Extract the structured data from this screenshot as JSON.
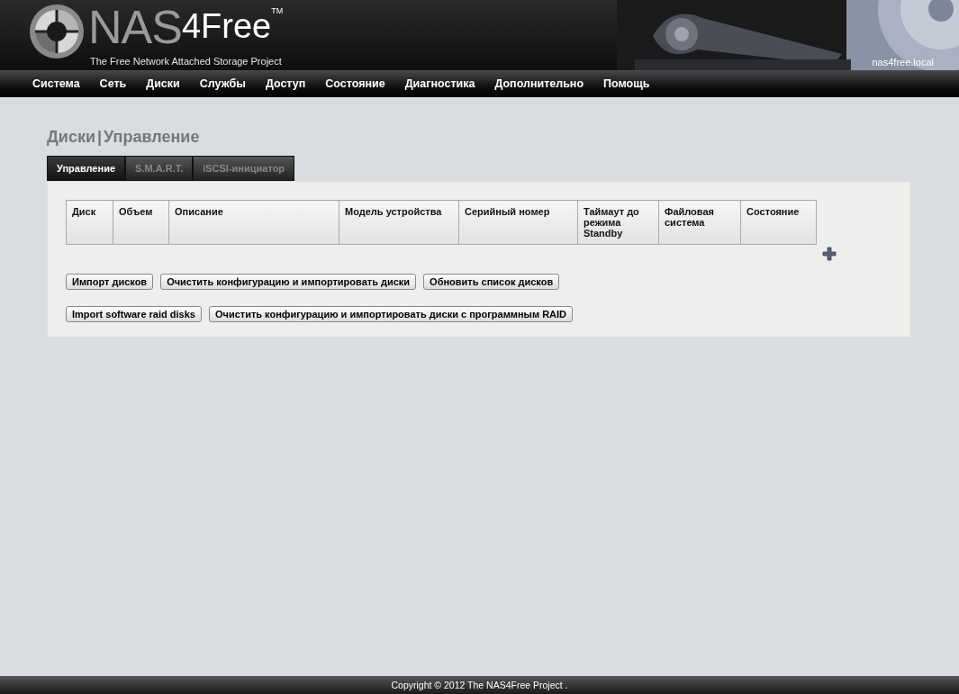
{
  "header": {
    "logo": {
      "prefix": "NAS",
      "suffix": "4Free",
      "trademark": "TM",
      "tagline": "The Free Network Attached Storage Project"
    },
    "hostname": "nas4free.local"
  },
  "menu": [
    "Система",
    "Сеть",
    "Диски",
    "Службы",
    "Доступ",
    "Состояние",
    "Диагностика",
    "Дополнительно",
    "Помощь"
  ],
  "page_title": {
    "section": "Диски",
    "separator": "|",
    "page": "Управление"
  },
  "tabs": [
    {
      "label": "Управление",
      "selected": true
    },
    {
      "label": "S.M.A.R.T.",
      "selected": false
    },
    {
      "label": "iSCSI-инициатор",
      "selected": false
    }
  ],
  "table": {
    "columns": [
      "Диск",
      "Объем",
      "Описание",
      "Модель устройства",
      "Серийный номер",
      "Таймаут до режима Standby",
      "Файловая система",
      "Состояние"
    ]
  },
  "button_rows": [
    [
      "Импорт дисков",
      "Очистить конфигурацию и импортировать диски",
      "Обновить список дисков"
    ],
    [
      "Import software raid disks",
      "Очистить конфигурацию и импортировать диски с программным RAID"
    ]
  ],
  "footer": "Copyright © 2012 The NAS4Free Project ."
}
